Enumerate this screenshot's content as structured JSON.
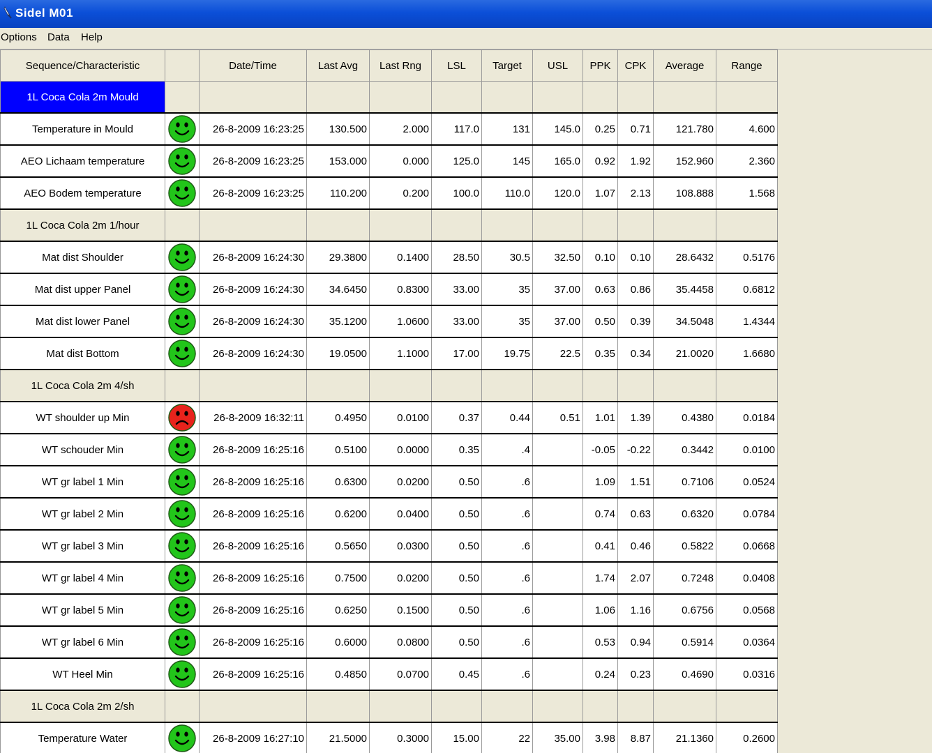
{
  "window": {
    "title": "Sidel M01"
  },
  "menu": [
    "Options",
    "Data",
    "Help"
  ],
  "columns": [
    "Sequence/Characteristic",
    "",
    "Date/Time",
    "Last Avg",
    "Last Rng",
    "LSL",
    "Target",
    "USL",
    "PPK",
    "CPK",
    "Average",
    "Range"
  ],
  "colors": {
    "ok": "#22c51a",
    "bad": "#e8231c",
    "selected": "#0000ff"
  },
  "rows": [
    {
      "type": "seq",
      "name": "1L Coca Cola 2m Mould",
      "selected": true
    },
    {
      "type": "item",
      "name": "Temperature in Mould",
      "status": "ok",
      "datetime": "26-8-2009 16:23:25",
      "last_avg": "130.500",
      "last_rng": "2.000",
      "lsl": "117.0",
      "target": "131",
      "usl": "145.0",
      "ppk": "0.25",
      "cpk": "0.71",
      "average": "121.780",
      "range": "4.600"
    },
    {
      "type": "item",
      "name": "AEO Lichaam temperature",
      "status": "ok",
      "datetime": "26-8-2009 16:23:25",
      "last_avg": "153.000",
      "last_rng": "0.000",
      "lsl": "125.0",
      "target": "145",
      "usl": "165.0",
      "ppk": "0.92",
      "cpk": "1.92",
      "average": "152.960",
      "range": "2.360"
    },
    {
      "type": "item",
      "name": "AEO Bodem temperature",
      "status": "ok",
      "datetime": "26-8-2009 16:23:25",
      "last_avg": "110.200",
      "last_rng": "0.200",
      "lsl": "100.0",
      "target": "110.0",
      "usl": "120.0",
      "ppk": "1.07",
      "cpk": "2.13",
      "average": "108.888",
      "range": "1.568"
    },
    {
      "type": "seq",
      "name": "1L Coca Cola 2m 1/hour"
    },
    {
      "type": "item",
      "name": "Mat dist Shoulder",
      "status": "ok",
      "datetime": "26-8-2009 16:24:30",
      "last_avg": "29.3800",
      "last_rng": "0.1400",
      "lsl": "28.50",
      "target": "30.5",
      "usl": "32.50",
      "ppk": "0.10",
      "cpk": "0.10",
      "average": "28.6432",
      "range": "0.5176"
    },
    {
      "type": "item",
      "name": "Mat dist upper Panel",
      "status": "ok",
      "datetime": "26-8-2009 16:24:30",
      "last_avg": "34.6450",
      "last_rng": "0.8300",
      "lsl": "33.00",
      "target": "35",
      "usl": "37.00",
      "ppk": "0.63",
      "cpk": "0.86",
      "average": "35.4458",
      "range": "0.6812"
    },
    {
      "type": "item",
      "name": "Mat dist lower Panel",
      "status": "ok",
      "datetime": "26-8-2009 16:24:30",
      "last_avg": "35.1200",
      "last_rng": "1.0600",
      "lsl": "33.00",
      "target": "35",
      "usl": "37.00",
      "ppk": "0.50",
      "cpk": "0.39",
      "average": "34.5048",
      "range": "1.4344"
    },
    {
      "type": "item",
      "name": "Mat dist Bottom",
      "status": "ok",
      "datetime": "26-8-2009 16:24:30",
      "last_avg": "19.0500",
      "last_rng": "1.1000",
      "lsl": "17.00",
      "target": "19.75",
      "usl": "22.5",
      "ppk": "0.35",
      "cpk": "0.34",
      "average": "21.0020",
      "range": "1.6680"
    },
    {
      "type": "seq",
      "name": "1L Coca Cola 2m 4/sh"
    },
    {
      "type": "item",
      "name": "WT shoulder up Min",
      "status": "bad",
      "datetime": "26-8-2009 16:32:11",
      "last_avg": "0.4950",
      "last_rng": "0.0100",
      "lsl": "0.37",
      "target": "0.44",
      "usl": "0.51",
      "ppk": "1.01",
      "cpk": "1.39",
      "average": "0.4380",
      "range": "0.0184"
    },
    {
      "type": "item",
      "name": "WT schouder Min",
      "status": "ok",
      "datetime": "26-8-2009 16:25:16",
      "last_avg": "0.5100",
      "last_rng": "0.0000",
      "lsl": "0.35",
      "target": ".4",
      "usl": "",
      "ppk": "-0.05",
      "cpk": "-0.22",
      "average": "0.3442",
      "range": "0.0100"
    },
    {
      "type": "item",
      "name": "WT gr label 1 Min",
      "status": "ok",
      "datetime": "26-8-2009 16:25:16",
      "last_avg": "0.6300",
      "last_rng": "0.0200",
      "lsl": "0.50",
      "target": ".6",
      "usl": "",
      "ppk": "1.09",
      "cpk": "1.51",
      "average": "0.7106",
      "range": "0.0524"
    },
    {
      "type": "item",
      "name": "WT gr label 2 Min",
      "status": "ok",
      "datetime": "26-8-2009 16:25:16",
      "last_avg": "0.6200",
      "last_rng": "0.0400",
      "lsl": "0.50",
      "target": ".6",
      "usl": "",
      "ppk": "0.74",
      "cpk": "0.63",
      "average": "0.6320",
      "range": "0.0784"
    },
    {
      "type": "item",
      "name": "WT gr label 3 Min",
      "status": "ok",
      "datetime": "26-8-2009 16:25:16",
      "last_avg": "0.5650",
      "last_rng": "0.0300",
      "lsl": "0.50",
      "target": ".6",
      "usl": "",
      "ppk": "0.41",
      "cpk": "0.46",
      "average": "0.5822",
      "range": "0.0668"
    },
    {
      "type": "item",
      "name": "WT gr label 4 Min",
      "status": "ok",
      "datetime": "26-8-2009 16:25:16",
      "last_avg": "0.7500",
      "last_rng": "0.0200",
      "lsl": "0.50",
      "target": ".6",
      "usl": "",
      "ppk": "1.74",
      "cpk": "2.07",
      "average": "0.7248",
      "range": "0.0408"
    },
    {
      "type": "item",
      "name": "WT gr label 5 Min",
      "status": "ok",
      "datetime": "26-8-2009 16:25:16",
      "last_avg": "0.6250",
      "last_rng": "0.1500",
      "lsl": "0.50",
      "target": ".6",
      "usl": "",
      "ppk": "1.06",
      "cpk": "1.16",
      "average": "0.6756",
      "range": "0.0568"
    },
    {
      "type": "item",
      "name": "WT gr label 6 Min",
      "status": "ok",
      "datetime": "26-8-2009 16:25:16",
      "last_avg": "0.6000",
      "last_rng": "0.0800",
      "lsl": "0.50",
      "target": ".6",
      "usl": "",
      "ppk": "0.53",
      "cpk": "0.94",
      "average": "0.5914",
      "range": "0.0364"
    },
    {
      "type": "item",
      "name": "WT Heel Min",
      "status": "ok",
      "datetime": "26-8-2009 16:25:16",
      "last_avg": "0.4850",
      "last_rng": "0.0700",
      "lsl": "0.45",
      "target": ".6",
      "usl": "",
      "ppk": "0.24",
      "cpk": "0.23",
      "average": "0.4690",
      "range": "0.0316"
    },
    {
      "type": "seq",
      "name": "1L Coca Cola 2m 2/sh"
    },
    {
      "type": "item",
      "name": "Temperature Water",
      "status": "ok",
      "datetime": "26-8-2009 16:27:10",
      "last_avg": "21.5000",
      "last_rng": "0.3000",
      "lsl": "15.00",
      "target": "22",
      "usl": "35.00",
      "ppk": "3.98",
      "cpk": "8.87",
      "average": "21.1360",
      "range": "0.2600"
    },
    {
      "type": "item",
      "name": "",
      "status": "ok",
      "datetime": "",
      "last_avg": "",
      "last_rng": "",
      "lsl": "",
      "target": "",
      "usl": "",
      "ppk": "",
      "cpk": "",
      "average": "",
      "range": ""
    }
  ]
}
